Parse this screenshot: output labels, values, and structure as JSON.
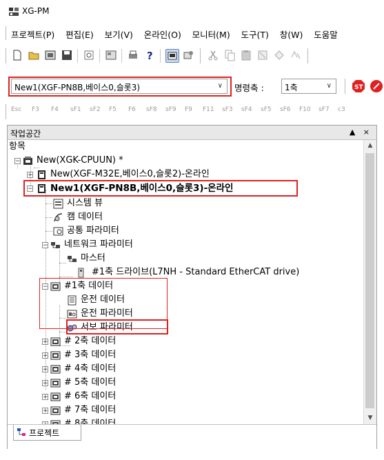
{
  "window": {
    "title": "XG-PM"
  },
  "menu": [
    "프로젝트(P)",
    "편집(E)",
    "보기(V)",
    "온라인(O)",
    "모니터(M)",
    "도구(T)",
    "창(W)",
    "도움말"
  ],
  "combos": {
    "module": "New1(XGF-PN8B,베이스0,슬롯3)",
    "command_axis_label": "명령축 :",
    "command_axis_value": "1축"
  },
  "fkeys": [
    "Esc",
    "F3",
    "F4",
    "sF1",
    "sF2",
    "F5",
    "F6",
    "sF8",
    "sF9",
    "F9",
    "F11",
    "sF3",
    "sF4",
    "sF5",
    "sF6",
    "F10",
    "sF7",
    "c3"
  ],
  "workspace": {
    "title": "작업공간",
    "controls": "▲ ×",
    "tree": {
      "root_label": "항목",
      "cpu": "New(XGK-CPUUN) *",
      "module1": "New(XGF-M32E,베이스0,슬롯2)-온라인",
      "module2": "New1(XGF-PN8B,베이스0,슬롯3)-온라인",
      "system_view": "시스템 뷰",
      "cam_data": "캠 데이터",
      "common_param": "공통 파라미터",
      "network_param": "네트워크 파라미터",
      "master": "마스터",
      "drive": "#1축 드라이브(L7NH - Standard EtherCAT drive)",
      "axis1": "#1축 데이터",
      "op_data": "운전 데이터",
      "op_param": "운전 파라미터",
      "servo_param": "서보 파라미터",
      "axes": [
        "# 2축 데이터",
        "# 3축 데이터",
        "# 4축 데이터",
        "# 5축 데이터",
        "# 6축 데이터",
        "# 7축 데이터",
        "# 8축 데이터"
      ]
    },
    "tab": "프로젝트"
  },
  "colors": {
    "highlight_red": "#e02020",
    "online_text": "#000000"
  }
}
